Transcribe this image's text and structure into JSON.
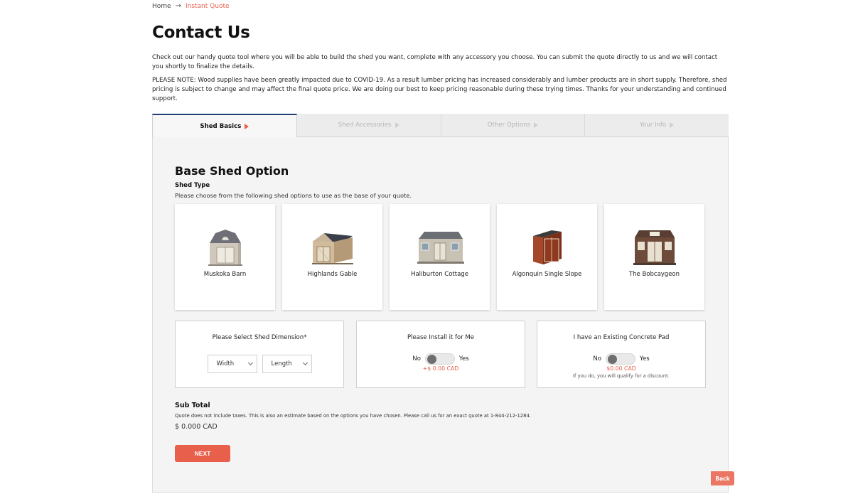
{
  "breadcrumb": {
    "home": "Home",
    "arrow": "→",
    "current": "Instant Quote"
  },
  "page": {
    "title": "Contact Us",
    "intro": "Check out our handy quote tool where you will be able to build the shed you want, complete with any accessory you choose. You can submit the quote directly to us and we will contact you shortly to finalize the details.",
    "note": "PLEASE NOTE: Wood supplies have been greatly impacted due to COVID-19. As a result lumber pricing has increased considerably and lumber products are in short supply. Therefore, shed pricing is subject to change and may affect the final quote price. We are doing our best to keep pricing reasonable during these trying times. Thanks for your understanding and continued support."
  },
  "tabs": [
    {
      "label": "Shed Basics",
      "active": true
    },
    {
      "label": "Shed Accessories",
      "active": false
    },
    {
      "label": "Other Options",
      "active": false
    },
    {
      "label": "Your Info",
      "active": false
    }
  ],
  "section": {
    "title": "Base Shed Option",
    "shed_type_label": "Shed Type",
    "shed_type_help": "Please choose from the following shed options to use as the base of your quote."
  },
  "sheds": [
    {
      "name": "Muskoka Barn",
      "icon": "barn-shed-image"
    },
    {
      "name": "Highlands Gable",
      "icon": "gable-shed-image"
    },
    {
      "name": "Haliburton Cottage",
      "icon": "cottage-shed-image"
    },
    {
      "name": "Algonquin Single Slope",
      "icon": "single-slope-shed-image"
    },
    {
      "name": "The Bobcaygeon",
      "icon": "bobcaygeon-shed-image"
    }
  ],
  "dimension": {
    "title": "Please Select Shed Dimension*",
    "width_placeholder": "Width",
    "length_placeholder": "Length"
  },
  "install": {
    "title": "Please Install it for Me",
    "no": "No",
    "yes": "Yes",
    "price": "+$ 0.00 CAD",
    "checked": false
  },
  "concrete": {
    "title": "I have an Existing Concrete Pad",
    "no": "No",
    "yes": "Yes",
    "price": "$0.00 CAD",
    "hint": "If you do, you will qualify for a discount.",
    "checked": false
  },
  "subtotal": {
    "label": "Sub Total",
    "note": "Quote does not include taxes. This is also an estimate based on the options you have chosen. Please call us for an exact quote at 1-844-212-1284.",
    "value": "$ 0.000 CAD"
  },
  "buttons": {
    "next": "NEXT",
    "back": "Back"
  },
  "colors": {
    "accent": "#e8604c",
    "active_tab_border": "#1f3f7a",
    "panel_bg": "#f4f4f4"
  }
}
